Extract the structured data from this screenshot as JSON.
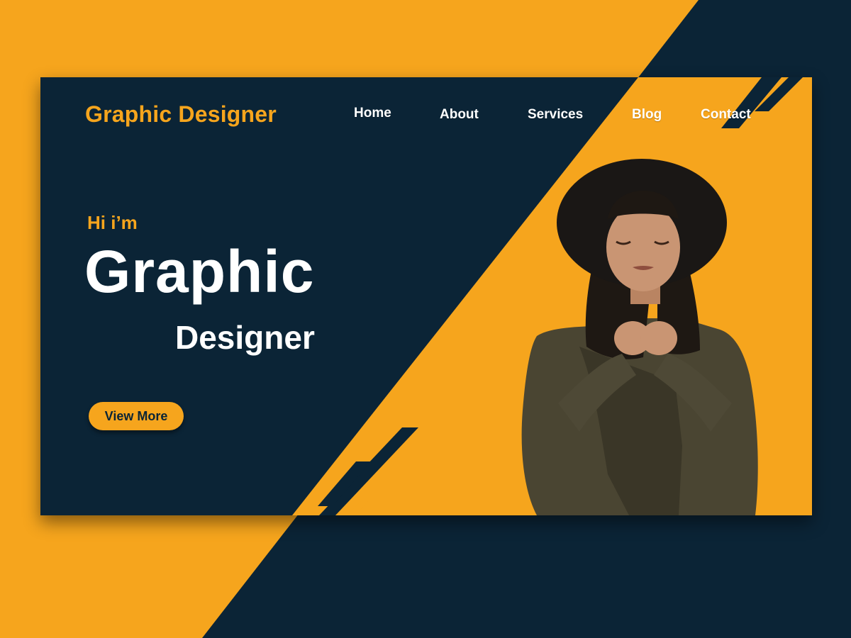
{
  "colors": {
    "navy": "#0B2436",
    "accent": "#F6A51D",
    "white": "#FFFFFF"
  },
  "header": {
    "logo": "Graphic Designer",
    "nav": [
      {
        "label": "Home"
      },
      {
        "label": "About"
      },
      {
        "label": "Services"
      },
      {
        "label": "Blog"
      },
      {
        "label": "Contact"
      }
    ]
  },
  "hero": {
    "greeting": "Hi i’m",
    "title_line1": "Graphic",
    "title_line2": "Designer",
    "cta_label": "View More"
  },
  "image": {
    "icon": "portrait-photo",
    "description_name": "hero-portrait"
  }
}
